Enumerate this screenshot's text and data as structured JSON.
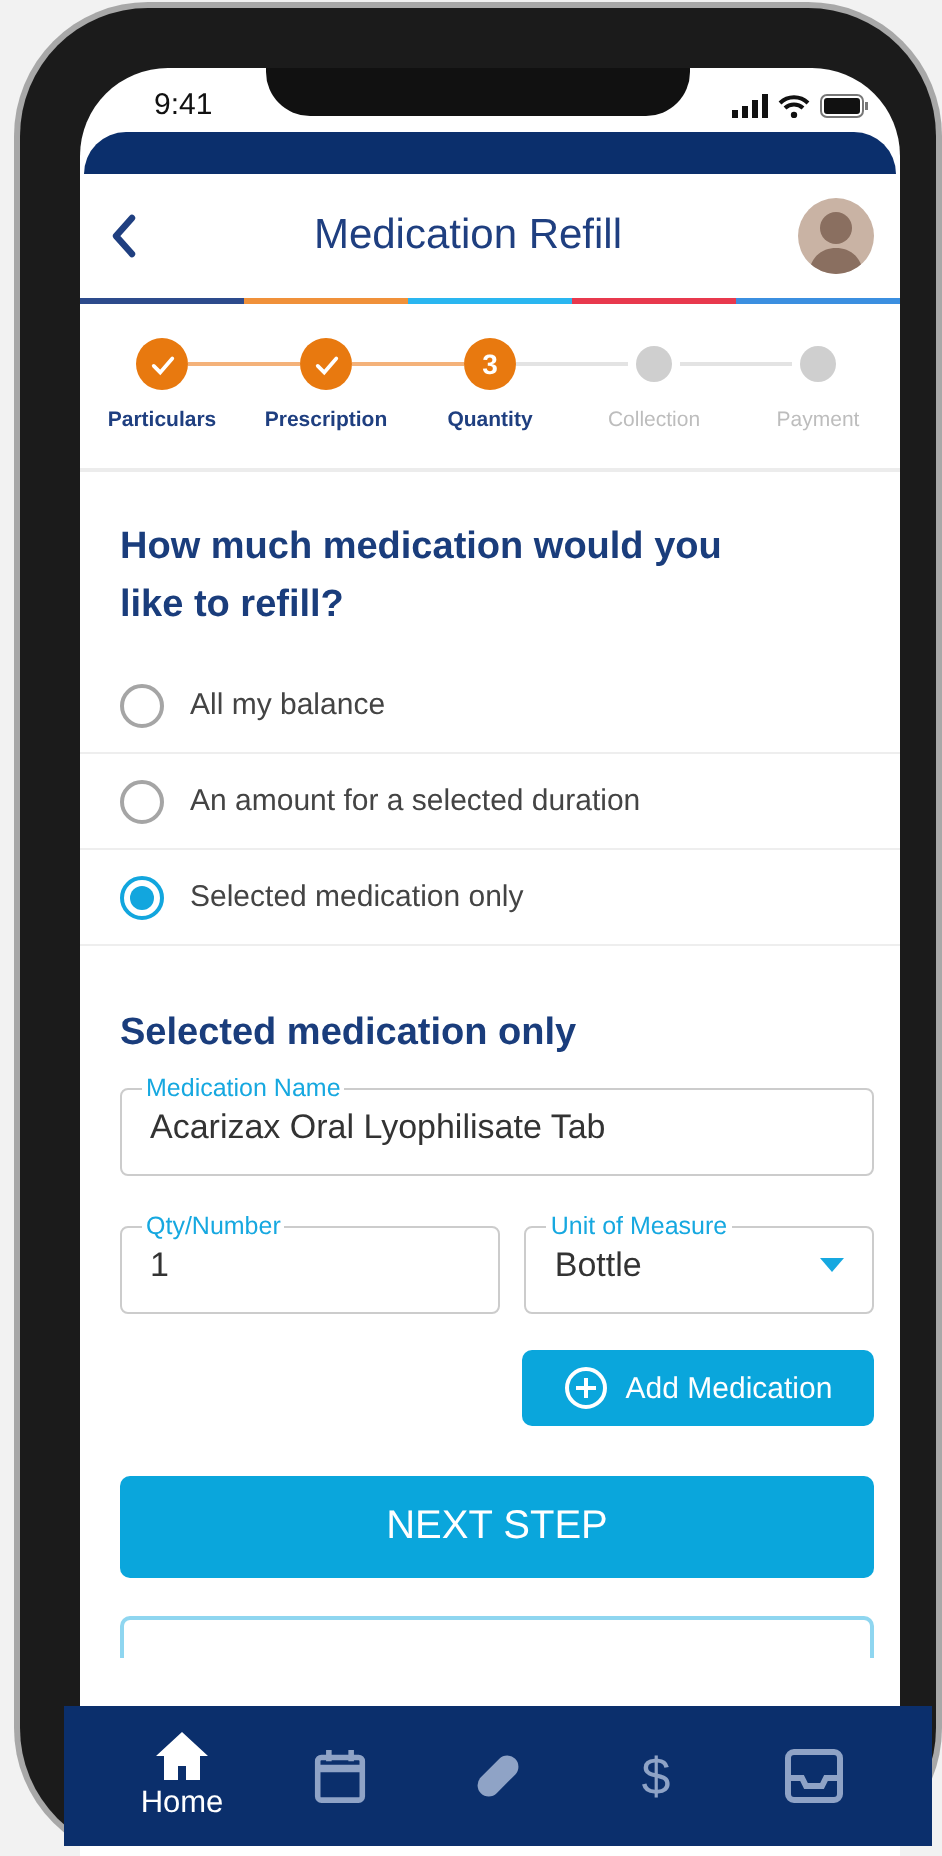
{
  "status_bar": {
    "time": "9:41"
  },
  "header": {
    "title": "Medication Refill"
  },
  "stepper": [
    {
      "label": "Particulars",
      "completed": true,
      "current": false
    },
    {
      "label": "Prescription",
      "completed": true,
      "current": false
    },
    {
      "label": "Quantity",
      "completed": false,
      "current": true,
      "number": "3"
    },
    {
      "label": "Collection",
      "completed": false,
      "current": false
    },
    {
      "label": "Payment",
      "completed": false,
      "current": false
    }
  ],
  "question": "How much medication would you like to refill?",
  "options": [
    {
      "label": "All my balance",
      "selected": false
    },
    {
      "label": "An amount for a selected duration",
      "selected": false
    },
    {
      "label": "Selected medication only",
      "selected": true
    }
  ],
  "section_title": "Selected medication only",
  "fields": [
    {
      "kind": "text",
      "label": "Medication Name",
      "value": "Acarizax Oral Lyophilisate Tab"
    },
    {
      "kind": "text",
      "label": "Qty/Number",
      "value": "1"
    },
    {
      "kind": "select",
      "label": "Unit of Measure",
      "value": "Bottle"
    }
  ],
  "add_button": "Add Medication",
  "next_button": "NEXT STEP",
  "nav": [
    {
      "kind": "home",
      "label": "Home",
      "selected": true
    },
    {
      "kind": "calendar",
      "selected": false
    },
    {
      "kind": "pill",
      "selected": false
    },
    {
      "kind": "glyph",
      "glyph": "$",
      "selected": false
    },
    {
      "kind": "inbox",
      "selected": false
    }
  ]
}
